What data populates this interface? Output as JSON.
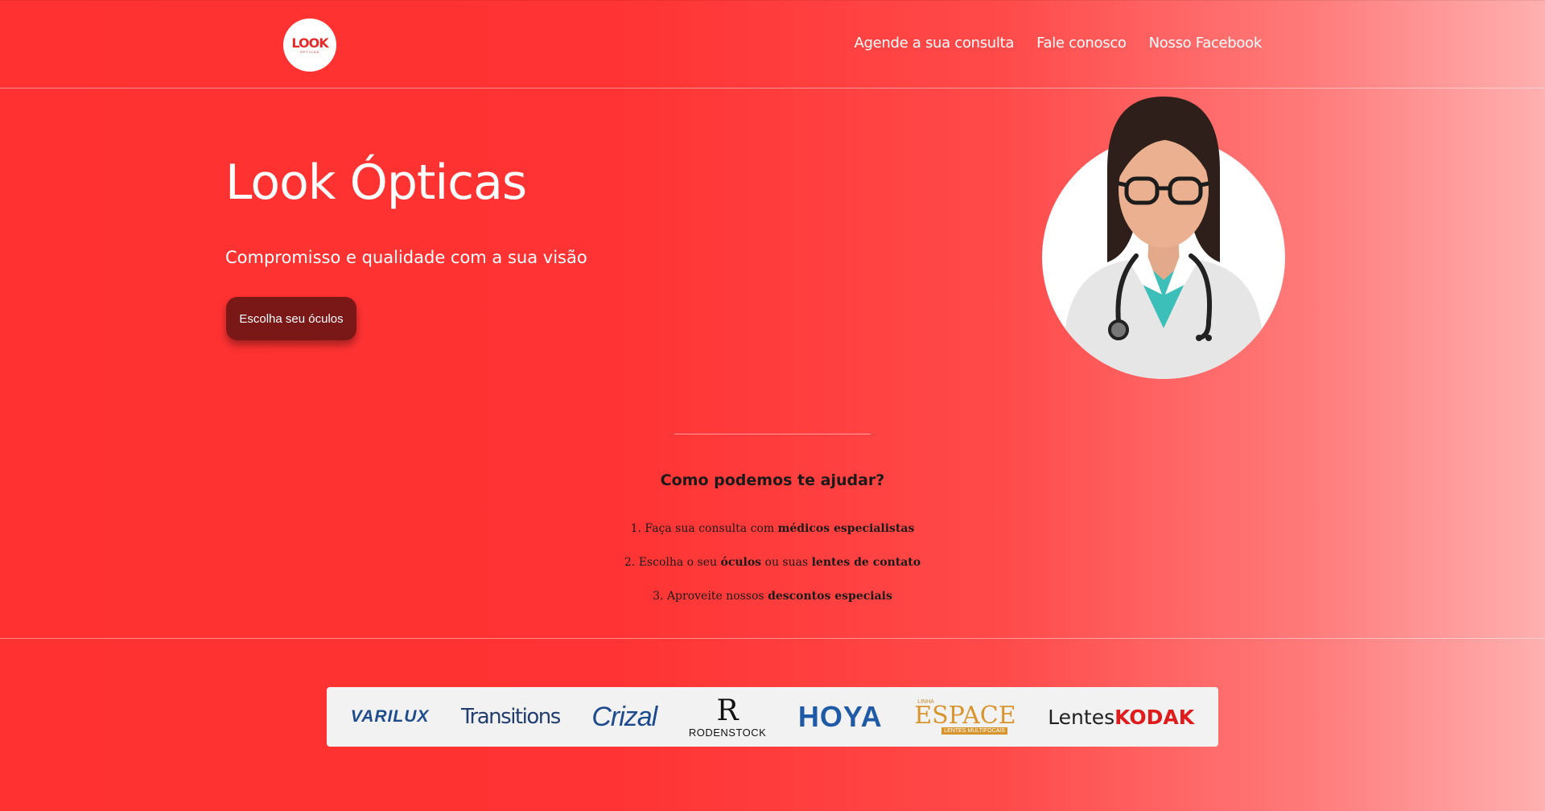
{
  "header": {
    "logo": {
      "text": "LOOK",
      "subtext": "ÓPTICAS"
    },
    "nav": [
      {
        "label": "Agende a sua consulta"
      },
      {
        "label": "Fale conosco"
      },
      {
        "label": "Nosso Facebook"
      }
    ]
  },
  "hero": {
    "title": "Look Ópticas",
    "subtitle": "Compromisso e qualidade com a sua visão",
    "cta_label": "Escolha seu óculos"
  },
  "help": {
    "title": "Como podemos te ajudar?",
    "steps": [
      {
        "prefix": "1. Faça sua consulta com ",
        "bold1": "médicos especialistas",
        "mid": "",
        "bold2": ""
      },
      {
        "prefix": "2. Escolha o seu ",
        "bold1": "óculos",
        "mid": " ou suas ",
        "bold2": "lentes de contato"
      },
      {
        "prefix": "3. Aproveite nossos ",
        "bold1": "descontos especiais",
        "mid": "",
        "bold2": ""
      }
    ]
  },
  "brands": {
    "varilux": "VARILUX",
    "transitions": "Transitions",
    "crizal": "Crizal",
    "rodenstock_mark": "R",
    "rodenstock": "RODENSTOCK",
    "hoya": "HOYA",
    "espace_top": "LINHA",
    "espace": "ESPACE",
    "espace_sub": "LENTES MULTIFOCAIS",
    "kodak_prefix": "Lentes ",
    "kodak": "KODAK"
  },
  "colors": {
    "background_start": "#ff3131",
    "background_end": "#ffb0b0",
    "cta_background": "#7a1717",
    "brand_bar": "#f2f2f2"
  },
  "icons": {
    "doctor_avatar": "doctor-avatar-illustration"
  }
}
